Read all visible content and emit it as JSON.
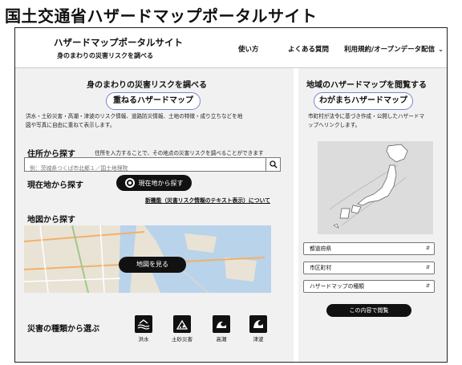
{
  "caption": "国土交通省ハザードマップポータルサイト",
  "header": {
    "title": "ハザードマップポータルサイト",
    "subtitle": "身のまわりの災害リスクを調べる",
    "nav": [
      "使い方",
      "よくある質問",
      "利用規約/オープンデータ配信"
    ]
  },
  "left": {
    "heading": "身のまわりの災害リスクを調べる",
    "pill": "重ねるハザードマップ",
    "description_lines": [
      "洪水・土砂災害・高潮・津波のリスク情報、道路防災情報、土地の特徴・成り立ちなどを地",
      "図や写真に自由に重ねて表示します。"
    ],
    "address": {
      "title": "住所から探す",
      "hint": "住所を入力することで、その地点の災害リスクを調べることができます",
      "placeholder": "例：茨城県つくば市北郷１／国土地理院"
    },
    "current": {
      "title": "現在地から探す",
      "button": "現在地から探す",
      "news_link": "新機能（災害リスク情報のテキスト表示）について"
    },
    "map": {
      "title": "地図から探す",
      "button": "地図を見る"
    },
    "types": {
      "title": "災害の種類から選ぶ",
      "items": [
        "洪水",
        "土砂災害",
        "高潮",
        "津波"
      ]
    }
  },
  "right": {
    "heading": "地域のハザードマップを閲覧する",
    "pill": "わがまちハザードマップ",
    "description_lines": [
      "市町村が法令に基づき作成・公開したハザードマ",
      "ップへリンクします。"
    ],
    "selects": [
      "都道府県",
      "市区町村",
      "ハザードマップの種類"
    ],
    "button": "この内容で閲覧"
  }
}
